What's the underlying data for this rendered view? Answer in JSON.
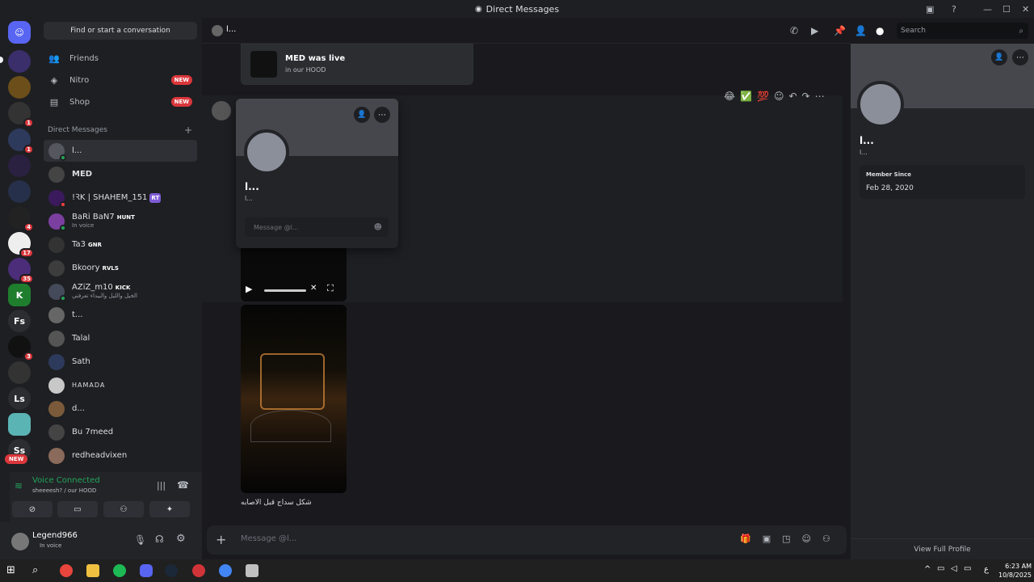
{
  "window": {
    "title": "Direct Messages"
  },
  "sidebar": {
    "find": "Find or start a conversation",
    "nav": [
      {
        "label": "Friends"
      },
      {
        "label": "Nitro",
        "badge": "NEW"
      },
      {
        "label": "Shop",
        "badge": "NEW"
      }
    ],
    "dm_header": "Direct Messages",
    "dms": [
      {
        "name": "l...",
        "sub": ""
      },
      {
        "name": "MED",
        "sub": ""
      },
      {
        "name": "!ꝚK | SHAHEM_151",
        "tag": "RT",
        "sub": ""
      },
      {
        "name": "BaRi BaN7",
        "tag": "HUNT",
        "sub": "In voice"
      },
      {
        "name": "Ta3",
        "tag": "GNR",
        "sub": ""
      },
      {
        "name": "Bkoory",
        "tag": "RVLS",
        "sub": ""
      },
      {
        "name": "AZiZ_m10",
        "tag": "KICK",
        "sub": "الخيل والليل والبيداء تعرفني"
      },
      {
        "name": "t...",
        "sub": ""
      },
      {
        "name": "Talal",
        "sub": ""
      },
      {
        "name": "Sath",
        "sub": ""
      },
      {
        "name": "HAMADA",
        "sub": ""
      },
      {
        "name": "d...",
        "sub": ""
      },
      {
        "name": "Bu 7meed",
        "sub": ""
      },
      {
        "name": "redheadvixen",
        "sub": ""
      }
    ]
  },
  "guild_badges": [
    "1",
    "1",
    "4",
    "17",
    "35",
    "3"
  ],
  "guild_labels": [
    "Fs",
    "Ls",
    "Ss"
  ],
  "guild_new": "NEW",
  "voice": {
    "status": "Voice Connected",
    "channel": "sheeeesh? / our HOOD"
  },
  "user": {
    "name": "Legend966",
    "status": "In voice"
  },
  "chat": {
    "header_name": "l...",
    "live_title": "MED was live",
    "live_sub": "in our HOOD",
    "caption": "شكل سداج قبل الاصابه",
    "input_placeholder": "Message @l..."
  },
  "popout": {
    "name": "l...",
    "tag": "l...",
    "message_placeholder": "Message @l..."
  },
  "search": {
    "placeholder": "Search"
  },
  "profile": {
    "name": "l...",
    "tag": "l...",
    "member_since_label": "Member Since",
    "member_since": "Feb 28, 2020",
    "view_full": "View Full Profile"
  },
  "taskbar": {
    "time": "6:23 AM",
    "date": "10/8/2025",
    "lang": "ع"
  }
}
